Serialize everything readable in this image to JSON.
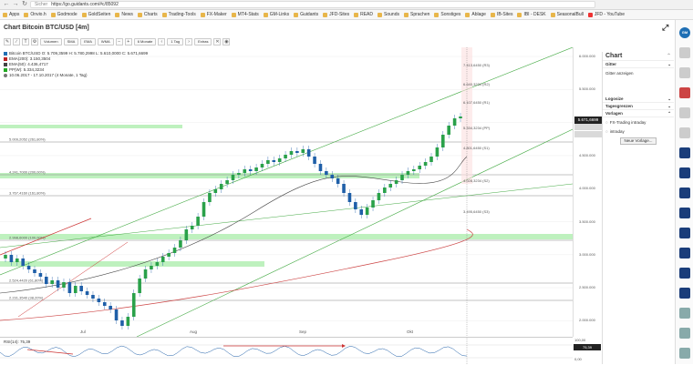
{
  "browser": {
    "url": "https://go.guidants.com/#c/85092",
    "secure_label": "Sicher"
  },
  "bookmarks": [
    "Apps",
    "Onvio.h",
    "Godmode",
    "GoldSeiten",
    "News",
    "Charts",
    "Trading-Tools",
    "FX-Maker",
    "MT4-Stats",
    "GM-Links",
    "Guidants",
    "JFD-Sites",
    "READ",
    "Sounds",
    "Sprachen",
    "Sonstiges",
    "Ablage",
    "IB-Sites",
    "IBI - DESK",
    "SeasonalBull",
    "JFD - YouTube"
  ],
  "app": {
    "title": "Chart Bitcoin BTC/USD [4m]"
  },
  "toolbar": {
    "buttons": [
      "Volumen",
      "SMA",
      "EMA",
      "WMA",
      "6 Monate",
      "1 Tag",
      "Extras"
    ]
  },
  "legend": {
    "ohlc": "Bitcoin BTC/USD  O: 5.709,3599  H: 5.780,2998  L: 5.610,0000  C: 5.671,6699",
    "ema200": "EMA(200): 3.150,3504",
    "ema50": "EMA(50): 4.436,4717",
    "pp": "PP(W): 5.334,3234",
    "range": "10.06.2017 - 17.10.2017  (4 Monate, 1 Tag)"
  },
  "chart_data": {
    "type": "candlestick",
    "title": "Chart Bitcoin BTC/USD [4m]",
    "ylim": [
      1800000,
      6200000
    ],
    "y_ticks": [
      "6.000.000",
      "5.500.000",
      "5.000.000",
      "4.500.000",
      "4.000.000",
      "3.500.000",
      "3.000.000",
      "2.500.000",
      "2.000.000"
    ],
    "current_price": "5.671,6699",
    "current_value": 5671.67,
    "x_labels": [
      "Jul",
      "Aug",
      "Sep",
      "Okt"
    ],
    "pivot_levels": [
      {
        "label": "7.413,6450 (R3)",
        "value": 7413.645
      },
      {
        "label": "6.640,3234 (R2)",
        "value": 6640.3234
      },
      {
        "label": "6.107,6450 (R1)",
        "value": 6107.645
      },
      {
        "label": "5.334,3234 (PP)",
        "value": 5334.3234
      },
      {
        "label": "4.801,6450 (S1)",
        "value": 4801.645
      },
      {
        "label": "4.028,3234 (S2)",
        "value": 4028.3234
      },
      {
        "label": "3.495,6450 (S3)",
        "value": 3495.645
      }
    ],
    "fib_levels": [
      {
        "label": "5.009,2052 (261,80%)"
      },
      {
        "label": "4.241,7000 (200,00%)"
      },
      {
        "label": "3.767,4160 (161,80%)"
      },
      {
        "label": "2.998,6000 (100,00%)"
      },
      {
        "label": "2.524,4420 (61,80%)"
      },
      {
        "label": "2.231,3540 (38,20%)"
      }
    ],
    "rsi_label": "RSI(14): 75,39",
    "rsi_value": "75,39",
    "rsi_ticks": [
      "100,00",
      "0,00"
    ]
  },
  "side_panel": {
    "title": "Chart",
    "sections": [
      "Gitter",
      "Logosize",
      "Tagesgrenzen",
      "Vorlagen"
    ],
    "gitter_label": "Gitter anzeigen",
    "vorlagen_items": [
      "FX-Trading intraday",
      "intraday"
    ],
    "new_template_button": "Neue Vorlage..."
  },
  "rail": {
    "badge": "GM"
  }
}
